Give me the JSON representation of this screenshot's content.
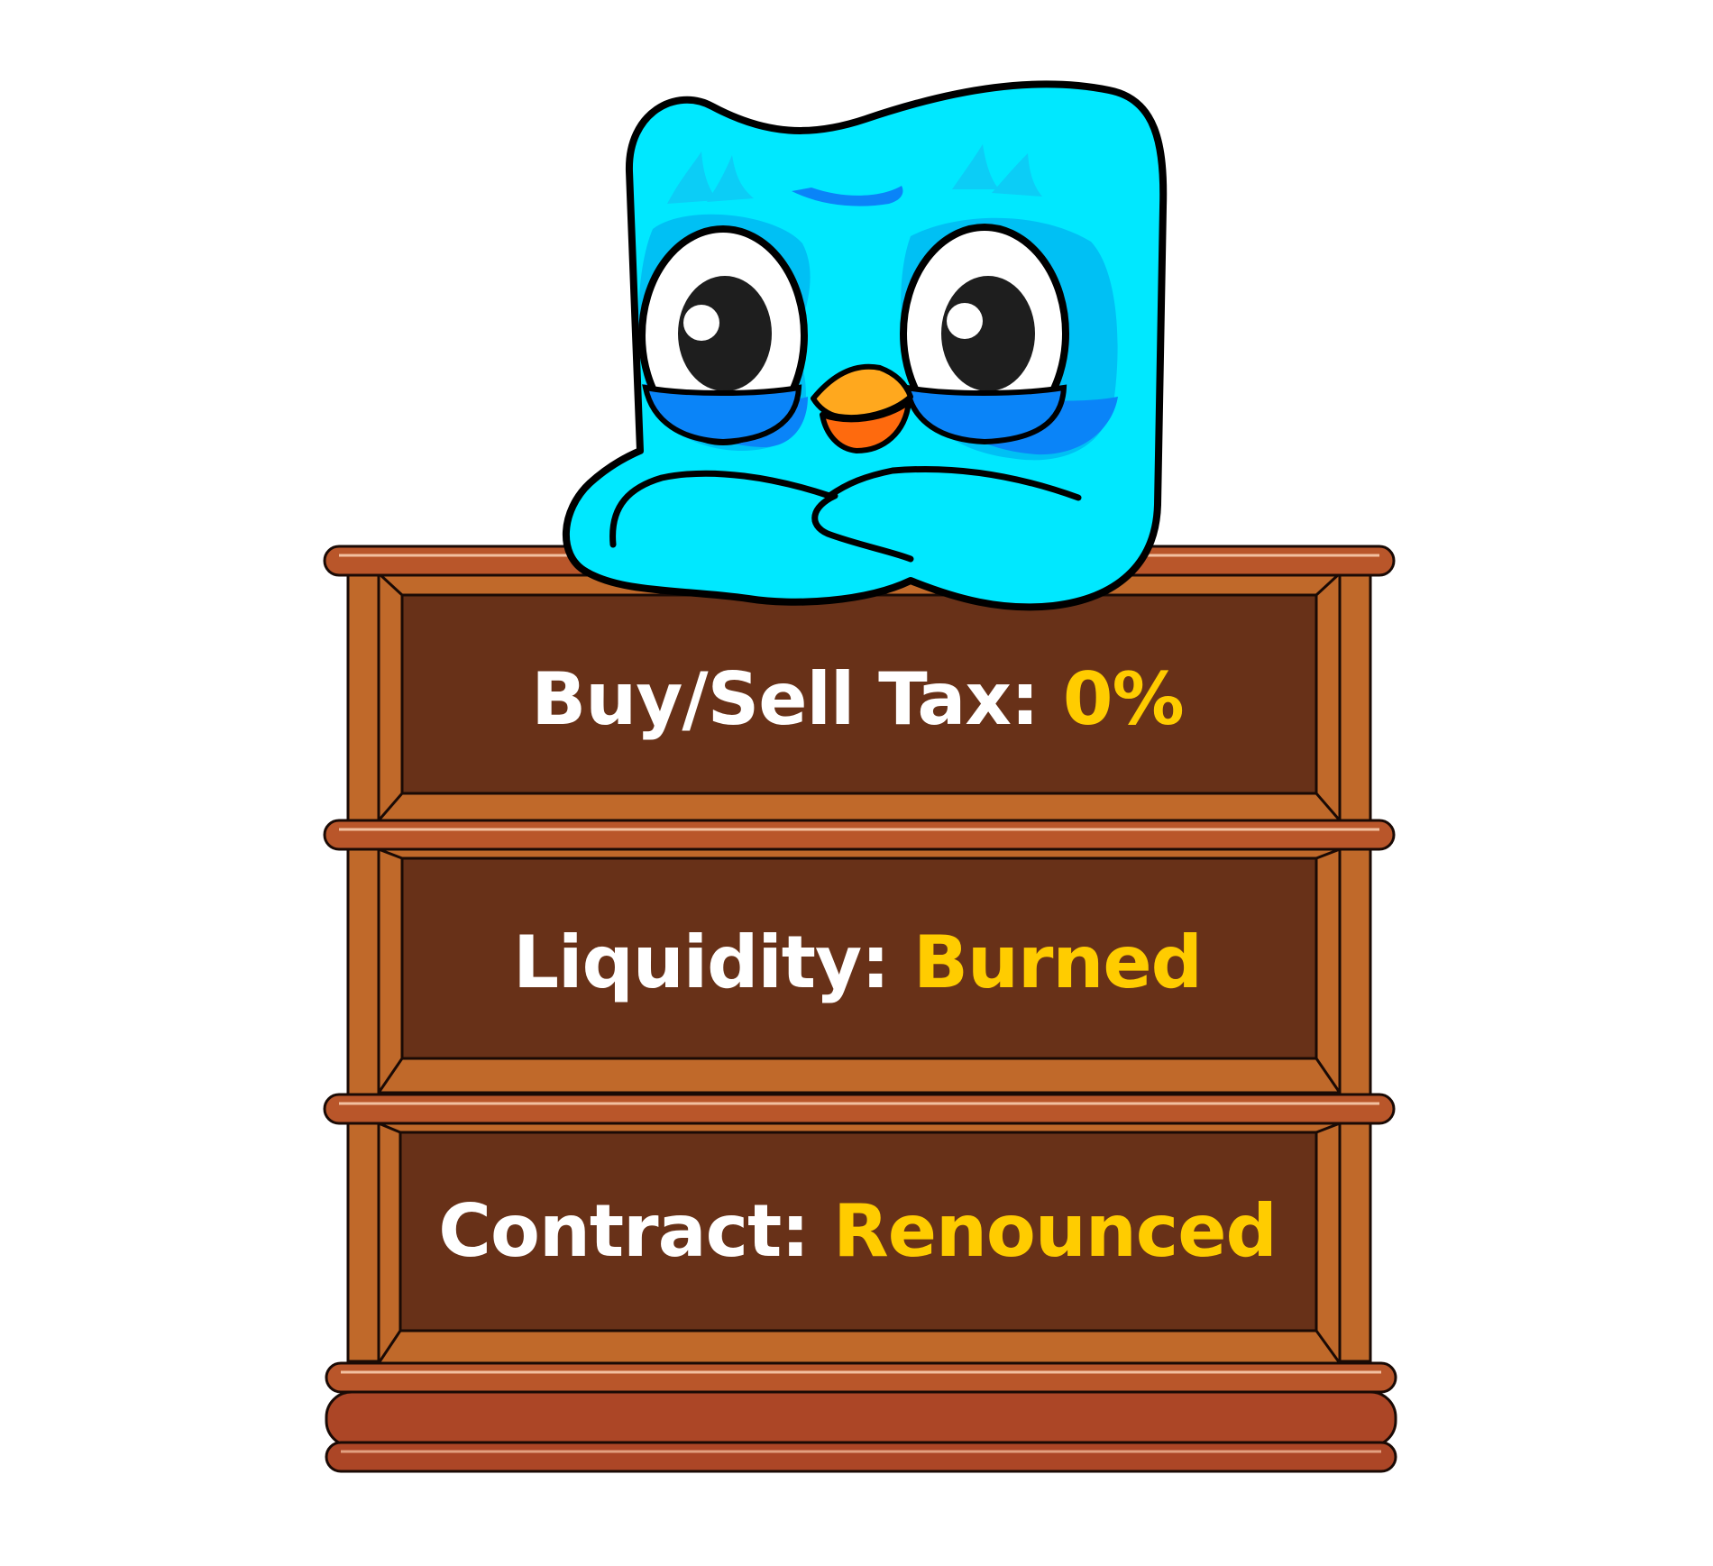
{
  "rows": [
    {
      "label": "Buy/Sell Tax:",
      "value": "0%"
    },
    {
      "label": "Liquidity:",
      "value": "Burned"
    },
    {
      "label": "Contract:",
      "value": "Renounced"
    }
  ],
  "colors": {
    "background": "#ffffff",
    "label": "#ffffff",
    "value": "#ffcc00",
    "panel": "#683118",
    "frame": "#c0692a",
    "shelf": "#b9562a",
    "mascot_body": "#00e8ff",
    "mascot_shade": "#0a84f8",
    "beak": "#ffa81e"
  },
  "icons": [
    "owl-mascot",
    "wooden-shelf"
  ]
}
